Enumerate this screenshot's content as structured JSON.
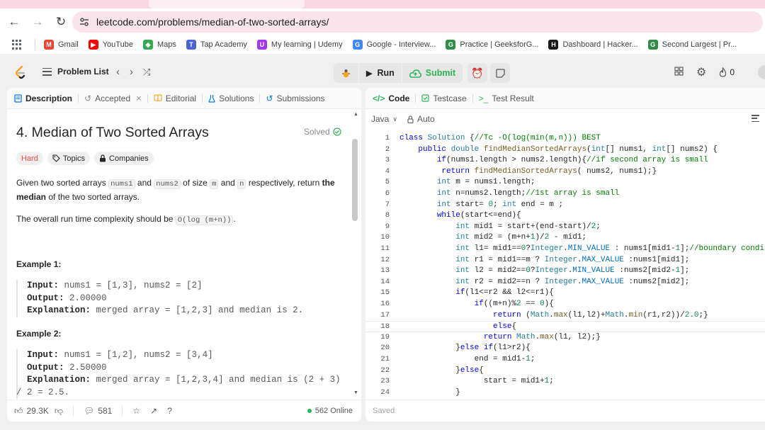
{
  "browser": {
    "url": "leetcode.com/problems/median-of-two-sorted-arrays/",
    "bookmarks": [
      {
        "label": "Gmail",
        "icon": "gmail-icon",
        "color": "#ea4335",
        "glyph": "M"
      },
      {
        "label": "YouTube",
        "icon": "youtube-icon",
        "color": "#ff0000",
        "glyph": "▶"
      },
      {
        "label": "Maps",
        "icon": "maps-icon",
        "color": "#34a853",
        "glyph": "◆"
      },
      {
        "label": "Tap Academy",
        "icon": "tap-academy-icon",
        "color": "#4a63d9",
        "glyph": "T"
      },
      {
        "label": "My learning | Udemy",
        "icon": "udemy-icon",
        "color": "#a435f0",
        "glyph": "U"
      },
      {
        "label": "Google - Interview...",
        "icon": "google-icon",
        "color": "#4285f4",
        "glyph": "G"
      },
      {
        "label": "Practice | GeeksforG...",
        "icon": "gfg-icon",
        "color": "#2f8d46",
        "glyph": "G"
      },
      {
        "label": "Dashboard | Hacker...",
        "icon": "hackerrank-icon",
        "color": "#1a1a1a",
        "glyph": "H"
      },
      {
        "label": "Second Largest | Pr...",
        "icon": "gfg-icon",
        "color": "#2f8d46",
        "glyph": "G"
      }
    ]
  },
  "nav": {
    "problem_list": "Problem List",
    "run": "Run",
    "submit": "Submit",
    "fire_count": "0"
  },
  "left": {
    "tabs": [
      "Description",
      "Accepted",
      "Editorial",
      "Solutions",
      "Submissions"
    ],
    "title": "4. Median of Two Sorted Arrays",
    "solved": "Solved",
    "chips": [
      "Hard",
      "Topics",
      "Companies"
    ],
    "p1": {
      "a": "Given two sorted arrays ",
      "c1": "nums1",
      "b": " and ",
      "c2": "nums2",
      "c": " of size ",
      "c3": "m",
      "d": " and ",
      "c4": "n",
      "e": " respectively, return ",
      "f": "the median",
      "g": " of the two sorted arrays."
    },
    "p2": {
      "a": "The overall run time complexity should be ",
      "c1": "O(log (m+n))",
      "b": "."
    },
    "example1": {
      "title": "Example 1:",
      "input_label": "Input:",
      "input": "nums1 = [1,3], nums2 = [2]",
      "output_label": "Output:",
      "output": "2.00000",
      "expl_label": "Explanation:",
      "expl": "merged array = [1,2,3] and median is 2."
    },
    "example2": {
      "title": "Example 2:",
      "input_label": "Input:",
      "input": "nums1 = [1,2], nums2 = [3,4]",
      "output_label": "Output:",
      "output": "2.50000",
      "expl_label": "Explanation:",
      "expl": "merged array = [1,2,3,4] and median is (2 + 3)",
      "expl2": "/ 2 = 2.5."
    },
    "footer": {
      "likes": "29.3K",
      "comments": "581",
      "online": "562 Online"
    }
  },
  "right": {
    "tabs": [
      "Code",
      "Testcase",
      "Test Result"
    ],
    "language": "Java",
    "mode": "Auto",
    "footer_status": "Saved",
    "current_line": 18,
    "code_lines": [
      "class Solution {//Tc -O(log(min(m,n))) BEST",
      "    public double findMedianSortedArrays(int[] nums1, int[] nums2) {",
      "        if(nums1.length > nums2.length){//if second array is small",
      "         return findMedianSortedArrays( nums2, nums1);}",
      "        int m = nums1.length;",
      "        int n=nums2.length;//1st array is small",
      "        int start= 0; int end = m ;",
      "        while(start<=end){",
      "            int mid1 = start+(end-start)/2;",
      "            int mid2 = (m+n+1)/2 - mid1;",
      "            int l1= mid1==0?Integer.MIN_VALUE : nums1[mid1-1];//boundary condition",
      "            int r1 = mid1==m ? Integer.MAX_VALUE :nums1[mid1];",
      "            int l2 = mid2==0?Integer.MIN_VALUE :nums2[mid2-1];",
      "            int r2 = mid2==n ? Integer.MAX_VALUE :nums2[mid2];",
      "            if(l1<=r2 && l2<=r1){",
      "                if((m+n)%2 == 0){",
      "                    return (Math.max(l1,l2)+Math.min(r1,r2))/2.0;}",
      "                    else{",
      "                  return Math.max(l1, l2);}",
      "            }else if(l1>r2){",
      "                end = mid1-1;",
      "            }else{",
      "                  start = mid1+1;",
      "            }"
    ]
  }
}
